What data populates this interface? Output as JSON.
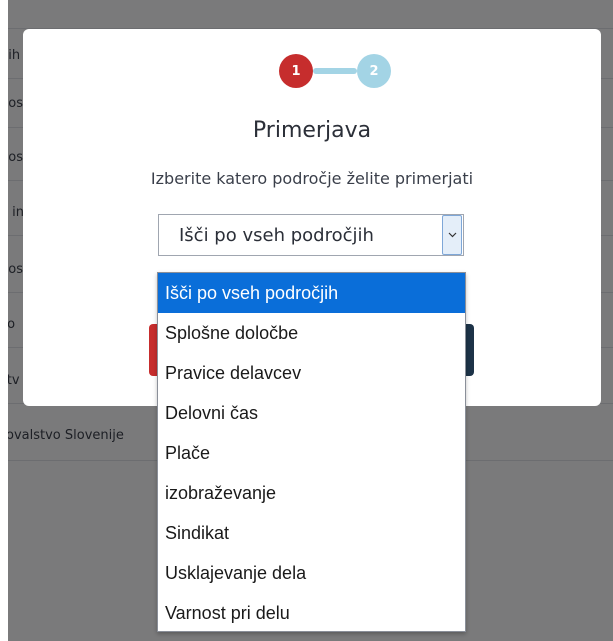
{
  "background": {
    "rows": [
      "nih",
      "nos",
      "nos",
      "e in",
      "nos",
      "ko",
      "stv",
      "ovalstvo Slovenije"
    ]
  },
  "stepper": {
    "step1": "1",
    "step2": "2"
  },
  "modal": {
    "title": "Primerjava",
    "subtitle": "Izberite katero področje želite primerjati"
  },
  "select": {
    "value": "Išči po vseh področjih"
  },
  "dropdown": {
    "options": [
      "Išči po vseh področjih",
      "Splošne določbe",
      "Pravice delavcev",
      "Delovni čas",
      "Plače",
      "izobraževanje",
      "Sindikat",
      "Usklajevanje dela",
      "Varnost pri delu"
    ]
  },
  "colors": {
    "step_active": "#c62d2d",
    "step_inactive": "#a3d4e5",
    "selected_option": "#0a6ed9"
  }
}
